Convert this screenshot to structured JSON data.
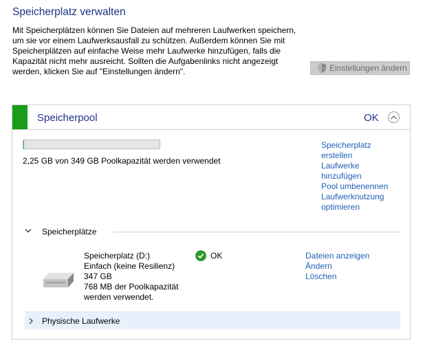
{
  "page": {
    "title": "Speicherplatz verwalten",
    "description_lines": [
      "Mit Speicherplätzen können Sie Dateien auf mehreren Laufwerken speichern,",
      "um sie vor einem Laufwerksausfall zu schützen. Außerdem können Sie mit",
      "Speicherplätzen auf einfache Weise mehr Laufwerke hinzufügen, falls die",
      "Kapazität nicht mehr ausreicht. Sollten die Aufgabenlinks nicht angezeigt",
      "werden, klicken Sie auf \"Einstellungen ändern\"."
    ],
    "settings_button": "Einstellungen ändern"
  },
  "pool": {
    "name": "Speicherpool",
    "status": "OK",
    "status_color": "#1a9c1a",
    "capacity_fraction": 0.0064,
    "capacity_text": "2,25 GB von 349 GB Poolkapazität werden verwendet",
    "links": [
      "Speicherplatz",
      "erstellen",
      "Laufwerke",
      "hinzufügen",
      "Pool umbenennen",
      "Laufwerknutzung",
      "optimieren"
    ]
  },
  "spaces_section": {
    "label": "Speicherplätze",
    "space": {
      "name": "Speicherplatz (D:)",
      "type": "Einfach (keine Resilienz)",
      "size": "347 GB",
      "usage_line1": "768 MB der Poolkapazität",
      "usage_line2": "werden verwendet.",
      "status": "OK",
      "links": [
        "Dateien anzeigen",
        "Ändern",
        "Löschen"
      ]
    }
  },
  "physical_section": {
    "label": "Physische Laufwerke"
  },
  "colors": {
    "heading": "#1e3287",
    "link": "#1e5fb4",
    "accent_green": "#1a9c1a"
  }
}
